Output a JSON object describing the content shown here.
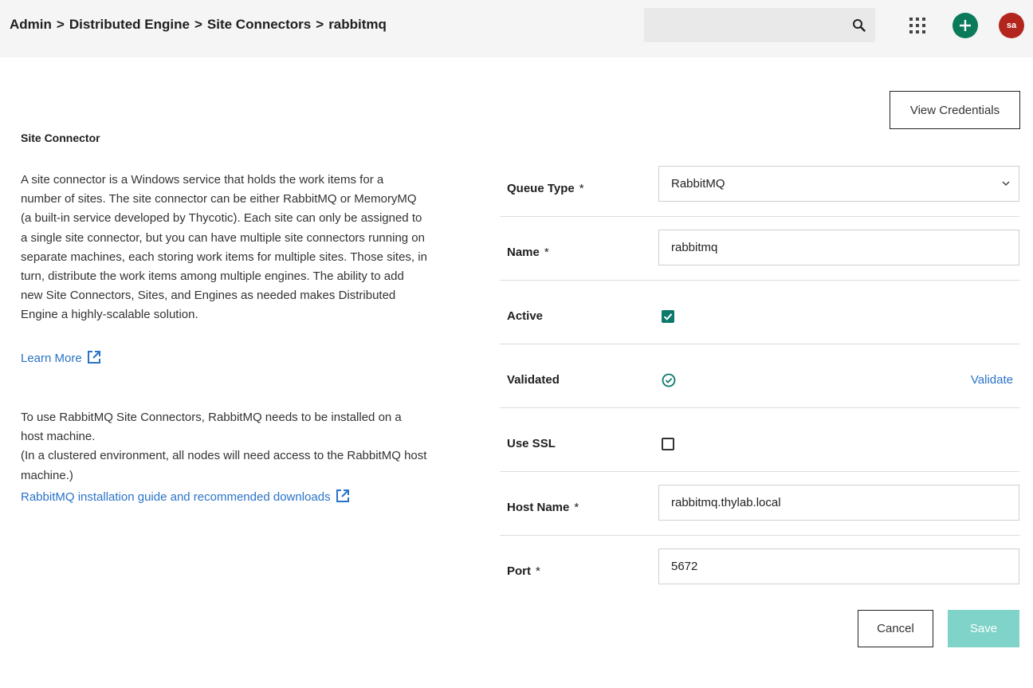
{
  "header": {
    "breadcrumb": [
      "Admin",
      "Distributed Engine",
      "Site Connectors",
      "rabbitmq"
    ],
    "separator": ">",
    "search": {
      "value": "",
      "placeholder": ""
    },
    "avatar_initials": "sa",
    "add_button_color": "#0b7a5a",
    "avatar_color": "#b3261e"
  },
  "sidebar_info": {
    "title": "Site Connector",
    "description": "A site connector is a Windows service that holds the work items for a number of sites. The site connector can be either RabbitMQ or MemoryMQ (a built-in service developed by Thycotic). Each site can only be assigned to a single site connector, but you can have multiple site connectors running on separate machines, each storing work items for multiple sites. Those sites, in turn, distribute the work items among multiple engines. The ability to add new Site Connectors, Sites, and Engines as needed makes Distributed Engine a highly-scalable solution.",
    "learn_more": "Learn More",
    "rabbit_note": "To use RabbitMQ Site Connectors, RabbitMQ needs to be installed on a host machine.",
    "cluster_note": "(In a clustered environment, all nodes will need access to the RabbitMQ host machine.)",
    "install_link": "RabbitMQ installation guide and recommended downloads"
  },
  "actions": {
    "view_credentials": "View Credentials",
    "cancel": "Cancel",
    "save": "Save",
    "save_color": "#7fd3c8"
  },
  "form": {
    "required_marker": "*",
    "queue_type": {
      "label": "Queue Type",
      "value": "RabbitMQ"
    },
    "name": {
      "label": "Name",
      "value": "rabbitmq"
    },
    "active": {
      "label": "Active",
      "checked": true
    },
    "validated": {
      "label": "Validated",
      "status": "valid",
      "action": "Validate"
    },
    "use_ssl": {
      "label": "Use SSL",
      "checked": false
    },
    "host_name": {
      "label": "Host Name",
      "value": "rabbitmq.thylab.local"
    },
    "port": {
      "label": "Port",
      "value": "5672"
    }
  },
  "colors": {
    "accent": "#0b7a6b",
    "link": "#2a73c8"
  }
}
